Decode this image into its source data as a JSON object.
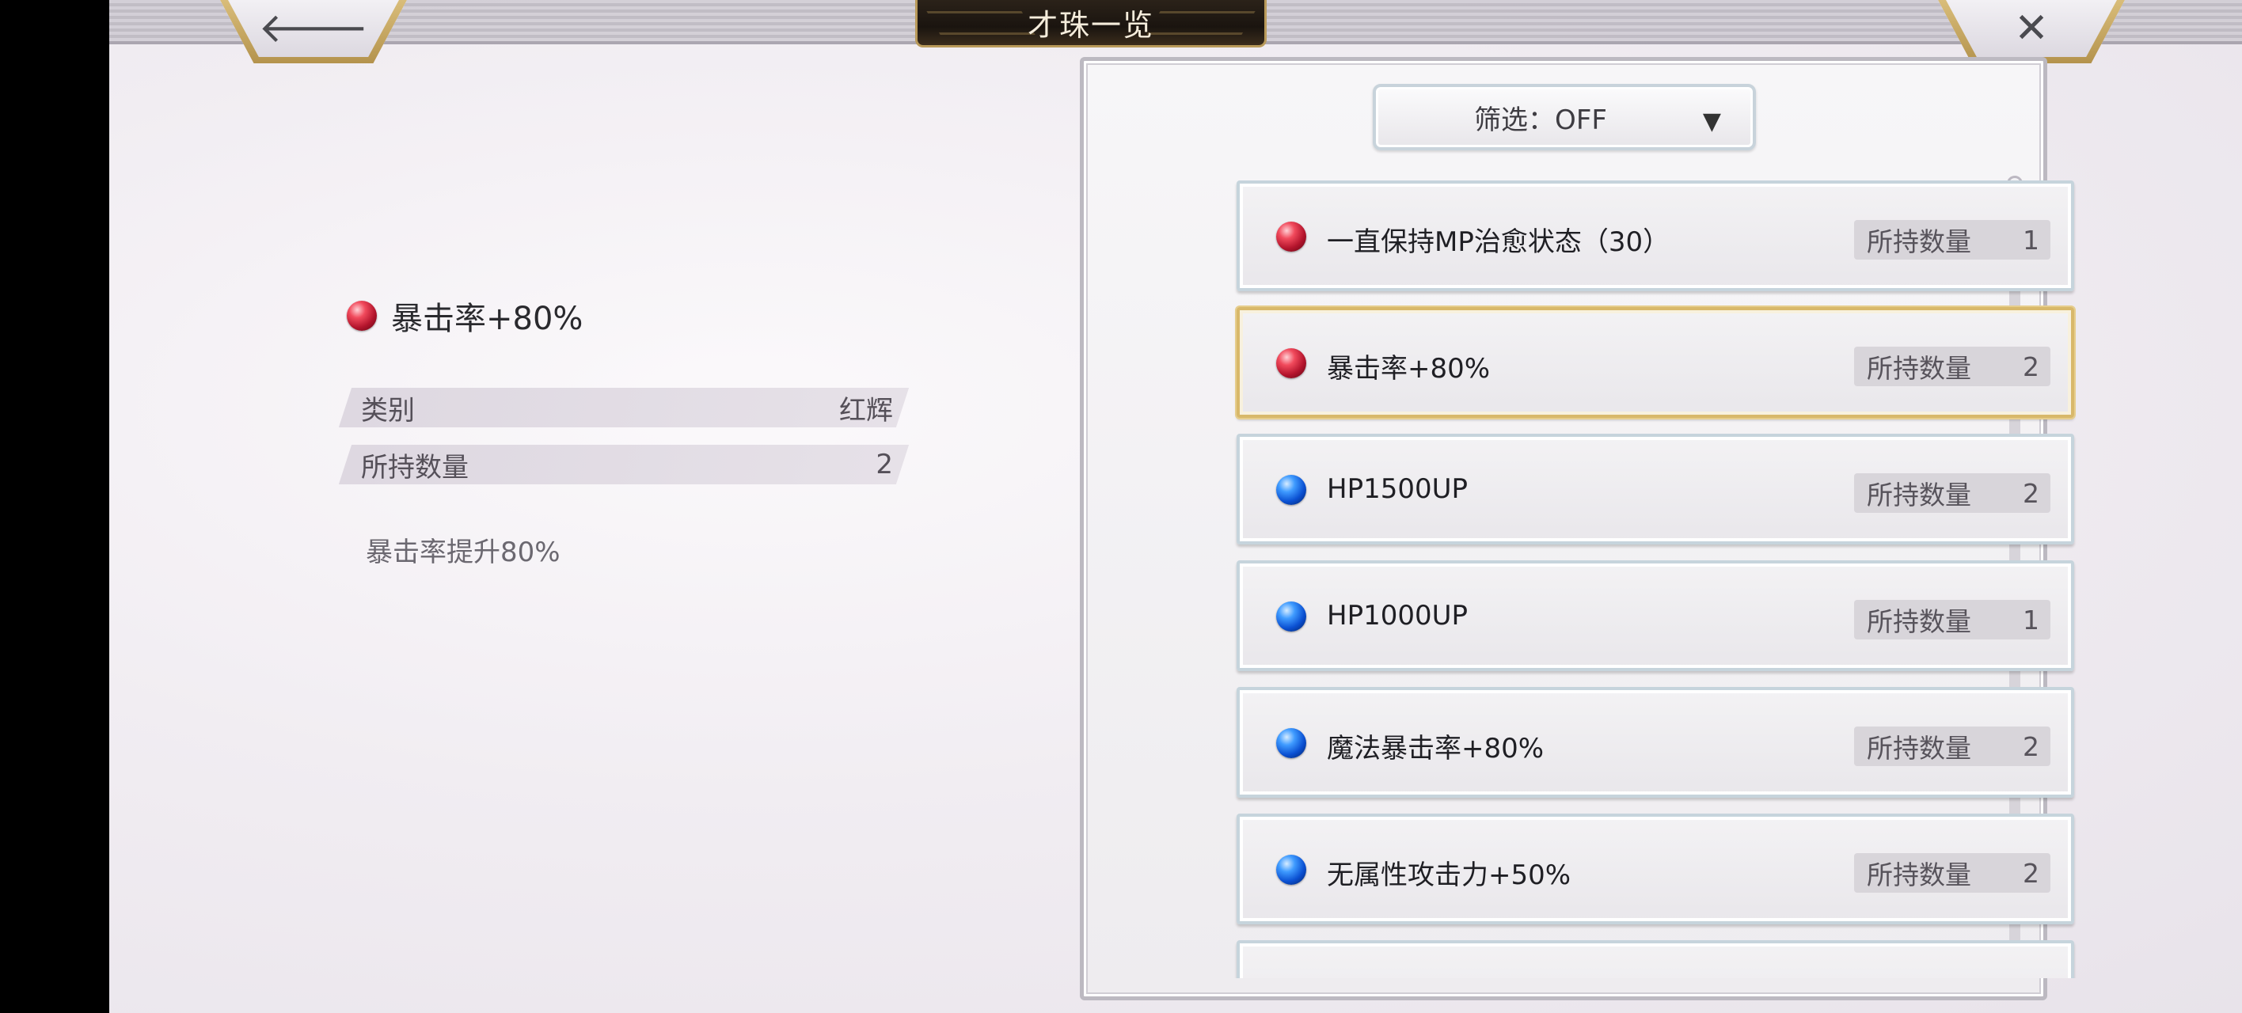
{
  "header": {
    "title": "才珠一览",
    "back_glyph": "🡐",
    "close_glyph": "✕"
  },
  "detail": {
    "name": "暴击率+80%",
    "orb_color": "red",
    "category_label": "类别",
    "category_value": "红辉",
    "held_label": "所持数量",
    "held_value": "2",
    "description": "暴击率提升80%"
  },
  "filter": {
    "label": "筛选：OFF",
    "caret": "▼"
  },
  "list": {
    "count_label": "所持数量",
    "items": [
      {
        "name": "一直保持MP治愈状态（30）",
        "count": "1",
        "orb": "red",
        "selected": false
      },
      {
        "name": "暴击率+80%",
        "count": "2",
        "orb": "red",
        "selected": true
      },
      {
        "name": "HP1500UP",
        "count": "2",
        "orb": "blue",
        "selected": false
      },
      {
        "name": "HP1000UP",
        "count": "1",
        "orb": "blue",
        "selected": false
      },
      {
        "name": "魔法暴击率+80%",
        "count": "2",
        "orb": "blue",
        "selected": false
      },
      {
        "name": "无属性攻击力+50%",
        "count": "2",
        "orb": "blue",
        "selected": false
      }
    ]
  },
  "colors": {
    "gold_accent": "#d8b86a",
    "red_orb": "#c8182f",
    "blue_orb": "#0a5ae0"
  }
}
